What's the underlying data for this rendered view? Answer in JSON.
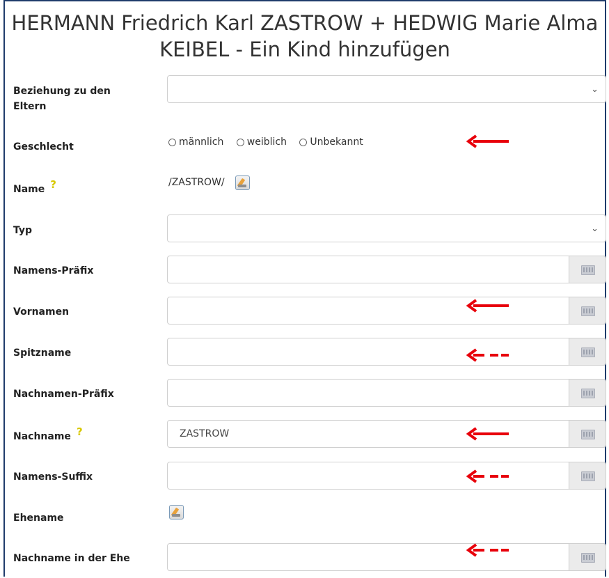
{
  "title": "HERMANN Friedrich Karl ZASTROW + HEDWIG Marie Alma KEIBEL - Ein Kind hinzufügen",
  "fields": {
    "relationship": {
      "label": "Beziehung zu den Eltern",
      "value": ""
    },
    "gender": {
      "label": "Geschlecht",
      "options": [
        "männlich",
        "weiblich",
        "Unbekannt"
      ],
      "selected": ""
    },
    "name": {
      "label": "Name",
      "value": "/ZASTROW/",
      "help_icon": "help-question-icon"
    },
    "type": {
      "label": "Typ",
      "value": ""
    },
    "name_prefix": {
      "label": "Namens-Präfix",
      "value": ""
    },
    "given_names": {
      "label": "Vornamen",
      "value": ""
    },
    "nickname": {
      "label": "Spitzname",
      "value": ""
    },
    "surname_prefix": {
      "label": "Nachnamen-Präfix",
      "value": ""
    },
    "surname": {
      "label": "Nachname",
      "value": "ZASTROW",
      "help_icon": "help-question-icon"
    },
    "name_suffix": {
      "label": "Namens-Suffix",
      "value": ""
    },
    "married_name": {
      "label": "Ehename"
    },
    "married_surname": {
      "label": "Nachname in der Ehe",
      "value": ""
    }
  },
  "icons": {
    "select_chevron": "chevron-down-icon",
    "keyboard": "keyboard-icon",
    "edit": "edit-pencil-icon",
    "annotation_arrow": "left-arrow-icon"
  },
  "colors": {
    "annotation_red": "#e8000b",
    "help_yellow": "#d8c800",
    "frame_border": "#1f3b6b"
  }
}
